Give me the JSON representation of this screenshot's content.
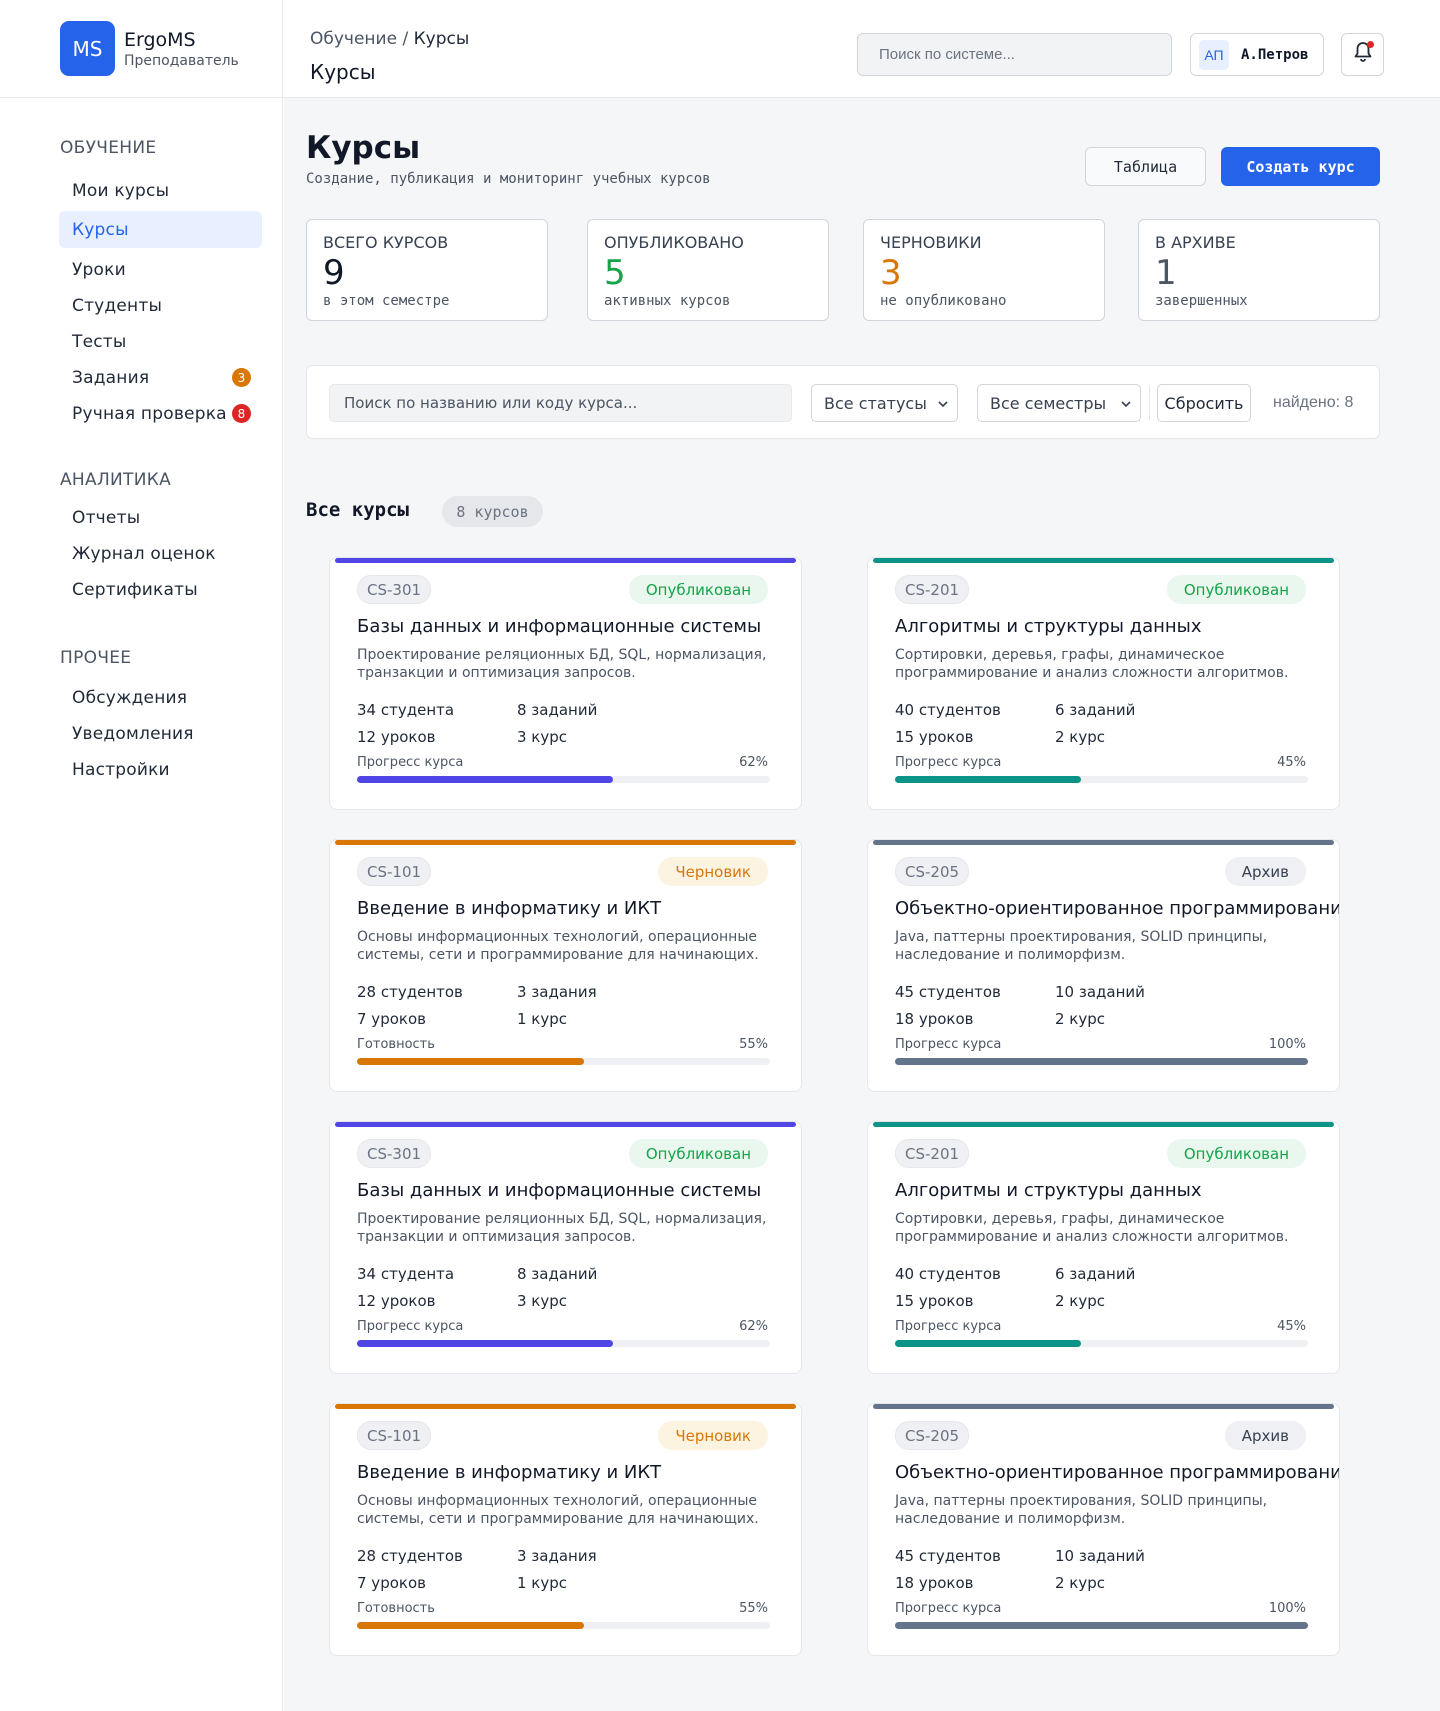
{
  "brand": {
    "logo": "MS",
    "name": "ErgoMS",
    "role": "Преподаватель"
  },
  "sidebar": {
    "sections": [
      {
        "title": "ОБУЧЕНИЕ"
      },
      {
        "title": "АНАЛИТИКА"
      },
      {
        "title": "ПРОЧЕЕ"
      }
    ],
    "items": [
      {
        "label": "Мои курсы"
      },
      {
        "label": "Курсы",
        "active": true
      },
      {
        "label": "Уроки"
      },
      {
        "label": "Студенты"
      },
      {
        "label": "Тесты"
      },
      {
        "label": "Задания",
        "badge": "3",
        "badge_color": "#d97706"
      },
      {
        "label": "Ручная проверка",
        "badge": "8",
        "badge_color": "#dc2626"
      },
      {
        "label": "Отчеты"
      },
      {
        "label": "Журнал оценок"
      },
      {
        "label": "Сертификаты"
      },
      {
        "label": "Обсуждения"
      },
      {
        "label": "Уведомления"
      },
      {
        "label": "Настройки"
      }
    ]
  },
  "topbar": {
    "breadcrumb_parent": "Обучение",
    "breadcrumb_sep": " / ",
    "breadcrumb_current": "Курсы",
    "title": "Курсы",
    "search_placeholder": "Поиск по системе...",
    "user_initials": "АП",
    "user_name": "А.Петров",
    "bell_icon": "bell-icon"
  },
  "page": {
    "title": "Курсы",
    "subtitle": "Создание, публикация и мониторинг учебных курсов",
    "table_button": "Таблица",
    "create_button": "Создать курс"
  },
  "stats": [
    {
      "label": "ВСЕГО КУРСОВ",
      "value": "9",
      "note": "в этом семестре",
      "color": "#111827"
    },
    {
      "label": "ОПУБЛИКОВАНО",
      "value": "5",
      "note": "активных курсов",
      "color": "#16a34a"
    },
    {
      "label": "ЧЕРНОВИКИ",
      "value": "3",
      "note": "не опубликовано",
      "color": "#d97706"
    },
    {
      "label": "В АРХИВЕ",
      "value": "1",
      "note": "завершенных",
      "color": "#4b5563"
    }
  ],
  "filters": {
    "search_placeholder": "Поиск по названию или коду курса...",
    "status_select": "Все статусы",
    "semester_select": "Все семестры",
    "reset": "Сбросить",
    "found": "найдено: 8"
  },
  "section": {
    "title": "Все курсы",
    "count": "8 курсов"
  },
  "colors": {
    "accent": "#2563eb",
    "indigo": "#4f46e5",
    "teal": "#0d9488",
    "orange": "#d97706",
    "slate": "#64748b"
  },
  "courses": [
    {
      "code": "CS-301",
      "status": "Опубликован",
      "status_type": "published",
      "title": "Базы данных и информационные системы",
      "desc": "Проектирование реляционных БД, SQL, нормализация, транзакции и оптимизация запросов.",
      "students": "34 студента",
      "tasks": "8 заданий",
      "lessons": "12 уроков",
      "year": "3 курс",
      "progress_label": "Прогресс курса",
      "progress_text": "62%",
      "progress": 62,
      "color": "#4f46e5"
    },
    {
      "code": "CS-201",
      "status": "Опубликован",
      "status_type": "published",
      "title": "Алгоритмы и структуры данных",
      "desc": "Сортировки, деревья, графы, динамическое программирование и анализ сложности алгоритмов.",
      "students": "40 студентов",
      "tasks": "6 заданий",
      "lessons": "15 уроков",
      "year": "2 курс",
      "progress_label": "Прогресс курса",
      "progress_text": "45%",
      "progress": 45,
      "color": "#0d9488"
    },
    {
      "code": "CS-101",
      "status": "Черновик",
      "status_type": "draft",
      "title": "Введение в информатику и ИКТ",
      "desc": "Основы информационных технологий, операционные системы, сети и программирование для начинающих.",
      "students": "28 студентов",
      "tasks": "3 задания",
      "lessons": "7 уроков",
      "year": "1 курс",
      "progress_label": "Готовность",
      "progress_text": "55%",
      "progress": 55,
      "color": "#d97706"
    },
    {
      "code": "CS-205",
      "status": "Архив",
      "status_type": "archive",
      "title": "Объектно-ориентированное программирование",
      "desc": "Java, паттерны проектирования, SOLID принципы, наследование и полиморфизм.",
      "students": "45 студентов",
      "tasks": "10 заданий",
      "lessons": "18 уроков",
      "year": "2 курс",
      "progress_label": "Прогресс курса",
      "progress_text": "100%",
      "progress": 100,
      "color": "#64748b"
    },
    {
      "code": "CS-301",
      "status": "Опубликован",
      "status_type": "published",
      "title": "Базы данных и информационные системы",
      "desc": "Проектирование реляционных БД, SQL, нормализация, транзакции и оптимизация запросов.",
      "students": "34 студента",
      "tasks": "8 заданий",
      "lessons": "12 уроков",
      "year": "3 курс",
      "progress_label": "Прогресс курса",
      "progress_text": "62%",
      "progress": 62,
      "color": "#4f46e5"
    },
    {
      "code": "CS-201",
      "status": "Опубликован",
      "status_type": "published",
      "title": "Алгоритмы и структуры данных",
      "desc": "Сортировки, деревья, графы, динамическое программирование и анализ сложности алгоритмов.",
      "students": "40 студентов",
      "tasks": "6 заданий",
      "lessons": "15 уроков",
      "year": "2 курс",
      "progress_label": "Прогресс курса",
      "progress_text": "45%",
      "progress": 45,
      "color": "#0d9488"
    },
    {
      "code": "CS-101",
      "status": "Черновик",
      "status_type": "draft",
      "title": "Введение в информатику и ИКТ",
      "desc": "Основы информационных технологий, операционные системы, сети и программирование для начинающих.",
      "students": "28 студентов",
      "tasks": "3 задания",
      "lessons": "7 уроков",
      "year": "1 курс",
      "progress_label": "Готовность",
      "progress_text": "55%",
      "progress": 55,
      "color": "#d97706"
    },
    {
      "code": "CS-205",
      "status": "Архив",
      "status_type": "archive",
      "title": "Объектно-ориентированное программирование",
      "desc": "Java, паттерны проектирования, SOLID принципы, наследование и полиморфизм.",
      "students": "45 студентов",
      "tasks": "10 заданий",
      "lessons": "18 уроков",
      "year": "2 курс",
      "progress_label": "Прогресс курса",
      "progress_text": "100%",
      "progress": 100,
      "color": "#64748b"
    }
  ]
}
